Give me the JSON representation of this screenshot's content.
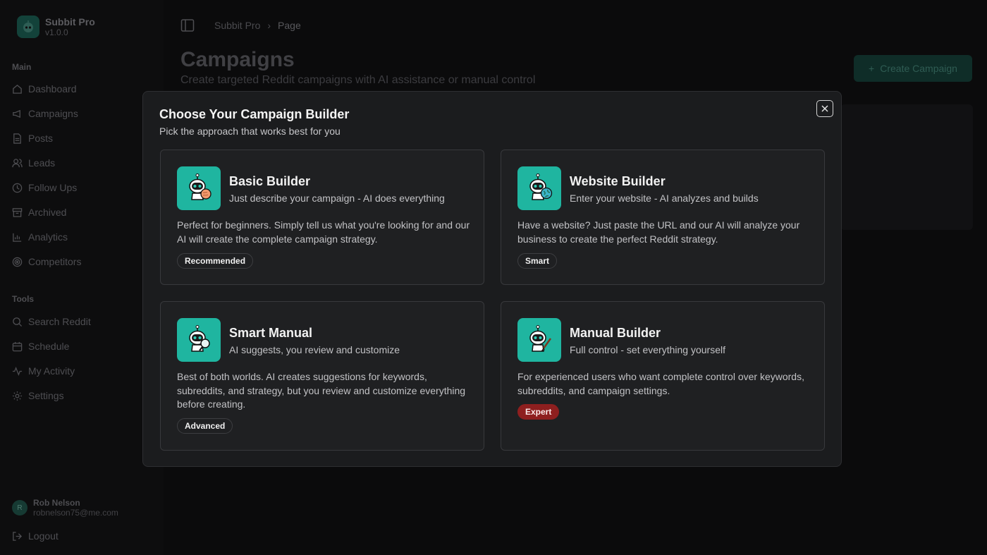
{
  "app": {
    "name": "Subbit Pro",
    "version": "v1.0.0"
  },
  "sidebar": {
    "main_label": "Main",
    "main_items": [
      {
        "label": "Dashboard",
        "icon": "home-icon"
      },
      {
        "label": "Campaigns",
        "icon": "megaphone-icon"
      },
      {
        "label": "Posts",
        "icon": "document-icon"
      },
      {
        "label": "Leads",
        "icon": "users-icon"
      },
      {
        "label": "Follow Ups",
        "icon": "clock-icon"
      },
      {
        "label": "Archived",
        "icon": "archive-icon"
      },
      {
        "label": "Analytics",
        "icon": "bar-chart-icon"
      },
      {
        "label": "Competitors",
        "icon": "target-icon"
      }
    ],
    "tools_label": "Tools",
    "tools_items": [
      {
        "label": "Search Reddit",
        "icon": "search-icon"
      },
      {
        "label": "Schedule",
        "icon": "calendar-icon"
      },
      {
        "label": "My Activity",
        "icon": "activity-icon"
      },
      {
        "label": "Settings",
        "icon": "gear-icon"
      }
    ],
    "user": {
      "initial": "R",
      "name": "Rob Nelson",
      "email": "robnelson75@me.com"
    },
    "logout_label": "Logout"
  },
  "header": {
    "breadcrumb": [
      "Subbit Pro",
      "Page"
    ],
    "title": "Campaigns",
    "subtitle": "Create targeted Reddit campaigns with AI assistance or manual control",
    "create_button": "Create Campaign"
  },
  "modal": {
    "title": "Choose Your Campaign Builder",
    "subtitle": "Pick the approach that works best for you",
    "cards": [
      {
        "title": "Basic Builder",
        "tagline": "Just describe your campaign - AI does everything",
        "description": "Perfect for beginners. Simply tell us what you're looking for and our AI will create the complete campaign strategy.",
        "badge": "Recommended",
        "icon": "robot-brain-icon"
      },
      {
        "title": "Website Builder",
        "tagline": "Enter your website - AI analyzes and builds",
        "description": "Have a website? Just paste the URL and our AI will analyze your business to create the perfect Reddit strategy.",
        "badge": "Smart",
        "icon": "robot-globe-icon"
      },
      {
        "title": "Smart Manual",
        "tagline": "AI suggests, you review and customize",
        "description": "Best of both worlds. AI creates suggestions for keywords, subreddits, and strategy, but you review and customize everything before creating.",
        "badge": "Advanced",
        "icon": "robot-magnifier-icon"
      },
      {
        "title": "Manual Builder",
        "tagline": "Full control - set everything yourself",
        "description": "For experienced users who want complete control over keywords, subreddits, and campaign settings.",
        "badge": "Expert",
        "icon": "robot-brush-icon"
      }
    ]
  },
  "colors": {
    "accent": "#1fb5a0",
    "expert_badge": "#8e1f1f",
    "modal_bg": "#1b1c1e"
  }
}
